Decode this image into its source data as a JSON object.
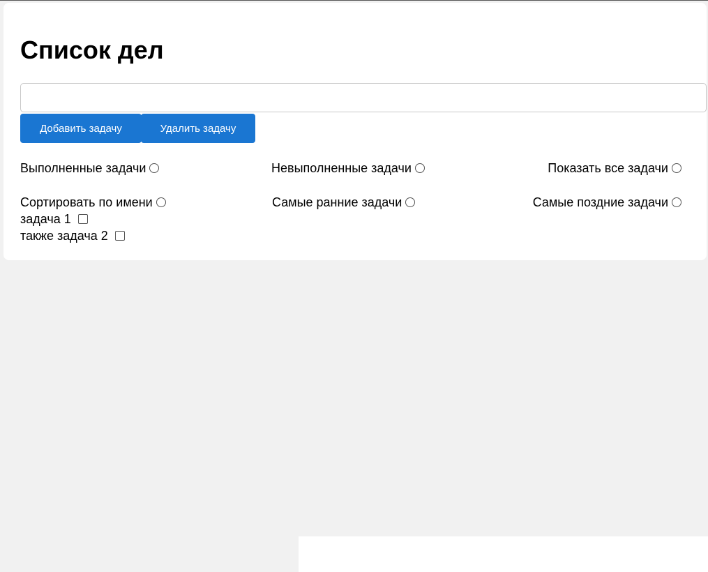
{
  "page": {
    "title": "Список дел"
  },
  "input": {
    "value": "",
    "placeholder": ""
  },
  "buttons": {
    "add_label": "Добавить задачу",
    "delete_label": "Удалить задачу"
  },
  "filters": {
    "completed": "Выполненные задачи",
    "not_completed": "Невыполненные задачи",
    "show_all": "Показать все задачи",
    "sort_by_name": "Сортировать по имени",
    "earliest": "Самые ранние задачи",
    "latest": "Самые поздние задачи"
  },
  "tasks": [
    {
      "label": "задача 1",
      "checked": false
    },
    {
      "label": "также задача 2",
      "checked": false
    }
  ],
  "colors": {
    "accent": "#1a76d2",
    "page_background": "#f1f1f1",
    "card_background": "#ffffff"
  }
}
